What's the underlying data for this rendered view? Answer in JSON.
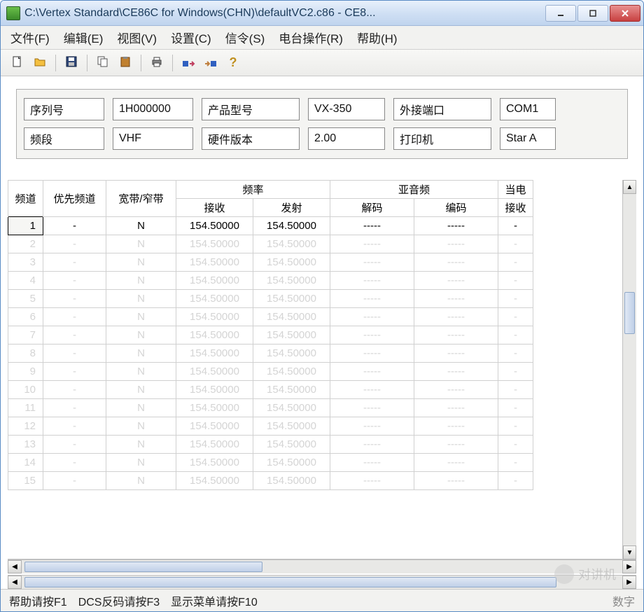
{
  "window": {
    "title": "C:\\Vertex Standard\\CE86C for Windows(CHN)\\defaultVC2.c86 - CE8..."
  },
  "menu": {
    "file": "文件(F)",
    "edit": "编辑(E)",
    "view": "视图(V)",
    "setup": "设置(C)",
    "signal": "信令(S)",
    "radio": "电台操作(R)",
    "help": "帮助(H)"
  },
  "info": {
    "serial_label": "序列号",
    "serial_value": "1H000000",
    "prodtype_label": "产品型号",
    "prodtype_value": "VX-350",
    "port_label": "外接端口",
    "port_value": "COM1",
    "band_label": "频段",
    "band_value": "VHF",
    "hwver_label": "硬件版本",
    "hwver_value": "2.00",
    "printer_label": "打印机",
    "printer_value": "Star A"
  },
  "grid": {
    "group_freq": "频率",
    "group_tone": "亚音频",
    "group_power": "当电",
    "col_ch": "频道",
    "col_prio": "优先频道",
    "col_bw": "宽带/窄带",
    "col_rx": "接收",
    "col_tx": "发射",
    "col_dec": "解码",
    "col_enc": "编码",
    "col_prx": "接收",
    "rows": [
      {
        "ch": "1",
        "prio": "-",
        "bw": "N",
        "rx": "154.50000",
        "tx": "154.50000",
        "dec": "-----",
        "enc": "-----",
        "prx": "-",
        "ghost": false
      },
      {
        "ch": "2",
        "prio": "-",
        "bw": "N",
        "rx": "154.50000",
        "tx": "154.50000",
        "dec": "-----",
        "enc": "-----",
        "prx": "-",
        "ghost": true
      },
      {
        "ch": "3",
        "prio": "-",
        "bw": "N",
        "rx": "154.50000",
        "tx": "154.50000",
        "dec": "-----",
        "enc": "-----",
        "prx": "-",
        "ghost": true
      },
      {
        "ch": "4",
        "prio": "-",
        "bw": "N",
        "rx": "154.50000",
        "tx": "154.50000",
        "dec": "-----",
        "enc": "-----",
        "prx": "-",
        "ghost": true
      },
      {
        "ch": "5",
        "prio": "-",
        "bw": "N",
        "rx": "154.50000",
        "tx": "154.50000",
        "dec": "-----",
        "enc": "-----",
        "prx": "-",
        "ghost": true
      },
      {
        "ch": "6",
        "prio": "-",
        "bw": "N",
        "rx": "154.50000",
        "tx": "154.50000",
        "dec": "-----",
        "enc": "-----",
        "prx": "-",
        "ghost": true
      },
      {
        "ch": "7",
        "prio": "-",
        "bw": "N",
        "rx": "154.50000",
        "tx": "154.50000",
        "dec": "-----",
        "enc": "-----",
        "prx": "-",
        "ghost": true
      },
      {
        "ch": "8",
        "prio": "-",
        "bw": "N",
        "rx": "154.50000",
        "tx": "154.50000",
        "dec": "-----",
        "enc": "-----",
        "prx": "-",
        "ghost": true
      },
      {
        "ch": "9",
        "prio": "-",
        "bw": "N",
        "rx": "154.50000",
        "tx": "154.50000",
        "dec": "-----",
        "enc": "-----",
        "prx": "-",
        "ghost": true
      },
      {
        "ch": "10",
        "prio": "-",
        "bw": "N",
        "rx": "154.50000",
        "tx": "154.50000",
        "dec": "-----",
        "enc": "-----",
        "prx": "-",
        "ghost": true
      },
      {
        "ch": "11",
        "prio": "-",
        "bw": "N",
        "rx": "154.50000",
        "tx": "154.50000",
        "dec": "-----",
        "enc": "-----",
        "prx": "-",
        "ghost": true
      },
      {
        "ch": "12",
        "prio": "-",
        "bw": "N",
        "rx": "154.50000",
        "tx": "154.50000",
        "dec": "-----",
        "enc": "-----",
        "prx": "-",
        "ghost": true
      },
      {
        "ch": "13",
        "prio": "-",
        "bw": "N",
        "rx": "154.50000",
        "tx": "154.50000",
        "dec": "-----",
        "enc": "-----",
        "prx": "-",
        "ghost": true
      },
      {
        "ch": "14",
        "prio": "-",
        "bw": "N",
        "rx": "154.50000",
        "tx": "154.50000",
        "dec": "-----",
        "enc": "-----",
        "prx": "-",
        "ghost": true
      },
      {
        "ch": "15",
        "prio": "-",
        "bw": "N",
        "rx": "154.50000",
        "tx": "154.50000",
        "dec": "-----",
        "enc": "-----",
        "prx": "-",
        "ghost": true
      }
    ]
  },
  "status": {
    "help": "帮助请按F1",
    "dcs": "DCS反码请按F3",
    "menu": "显示菜单请按F10",
    "right": "数字"
  },
  "watermark": "对讲机"
}
